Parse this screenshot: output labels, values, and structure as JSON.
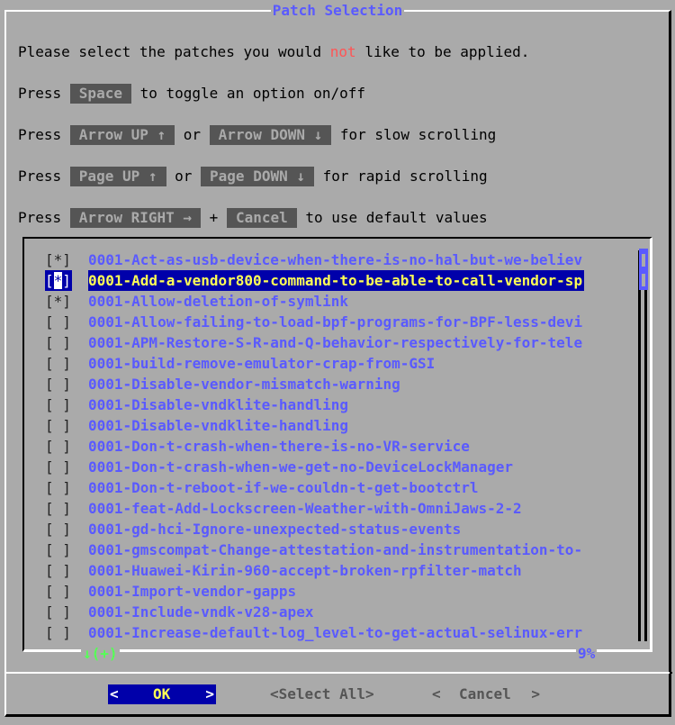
{
  "dialog": {
    "title": "Patch Selection",
    "intro_before": "Please select the patches you would ",
    "intro_emph": "not",
    "intro_after": " like to be applied.",
    "help": [
      {
        "prefix": "Press ",
        "key1": "Space",
        "mid": "",
        "key2": "",
        "suffix": " to toggle an option on/off"
      },
      {
        "prefix": "Press ",
        "key1": "Arrow UP ↑",
        "mid": " or ",
        "key2": "Arrow DOWN ↓",
        "suffix": " for slow scrolling"
      },
      {
        "prefix": "Press ",
        "key1": "Page UP ↑",
        "mid": " or ",
        "key2": "Page DOWN ↓",
        "suffix": " for rapid scrolling"
      },
      {
        "prefix": "Press ",
        "key1": "Arrow RIGHT →",
        "mid": " + ",
        "key2": "Cancel",
        "suffix": " to use default values"
      }
    ]
  },
  "list": {
    "items": [
      {
        "checked": "[*]",
        "name": "0001-Act-as-usb-device-when-there-is-no-hal-but-we-believ"
      },
      {
        "checked": "[*]",
        "name": "0001-Add-a-vendor800-command-to-be-able-to-call-vendor-sp",
        "selected": true
      },
      {
        "checked": "[*]",
        "name": "0001-Allow-deletion-of-symlink"
      },
      {
        "checked": "[ ]",
        "name": "0001-Allow-failing-to-load-bpf-programs-for-BPF-less-devi"
      },
      {
        "checked": "[ ]",
        "name": "0001-APM-Restore-S-R-and-Q-behavior-respectively-for-tele"
      },
      {
        "checked": "[ ]",
        "name": "0001-build-remove-emulator-crap-from-GSI"
      },
      {
        "checked": "[ ]",
        "name": "0001-Disable-vendor-mismatch-warning"
      },
      {
        "checked": "[ ]",
        "name": "0001-Disable-vndklite-handling"
      },
      {
        "checked": "[ ]",
        "name": "0001-Disable-vndklite-handling"
      },
      {
        "checked": "[ ]",
        "name": "0001-Don-t-crash-when-there-is-no-VR-service"
      },
      {
        "checked": "[ ]",
        "name": "0001-Don-t-crash-when-we-get-no-DeviceLockManager"
      },
      {
        "checked": "[ ]",
        "name": "0001-Don-t-reboot-if-we-couldn-t-get-bootctrl"
      },
      {
        "checked": "[ ]",
        "name": "0001-feat-Add-Lockscreen-Weather-with-OmniJaws-2-2"
      },
      {
        "checked": "[ ]",
        "name": "0001-gd-hci-Ignore-unexpected-status-events"
      },
      {
        "checked": "[ ]",
        "name": "0001-gmscompat-Change-attestation-and-instrumentation-to-"
      },
      {
        "checked": "[ ]",
        "name": "0001-Huawei-Kirin-960-accept-broken-rpfilter-match"
      },
      {
        "checked": "[ ]",
        "name": "0001-Import-vendor-gapps"
      },
      {
        "checked": "[ ]",
        "name": "0001-Include-vndk-v28-apex"
      },
      {
        "checked": "[ ]",
        "name": "0001-Increase-default-log_level-to-get-actual-selinux-err"
      }
    ],
    "more_indicator": "↓(+)",
    "scroll_percent": "9%"
  },
  "buttons": {
    "ok": "OK",
    "select_all": "<Select All>",
    "cancel": "Cancel"
  },
  "colors": {
    "background": "#aaaaaa",
    "accent": "#5a5aff",
    "highlight_bg": "#0000aa",
    "highlight_fg": "#ffff55",
    "emphasis": "#ff5555",
    "more_indicator": "#55ff55"
  }
}
